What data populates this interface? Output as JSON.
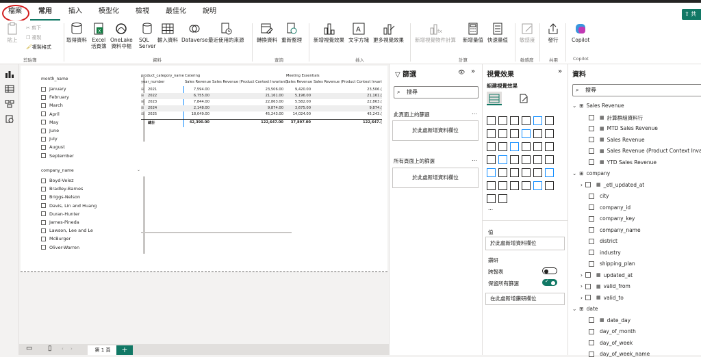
{
  "menu": {
    "tabs": [
      "檔案",
      "常用",
      "插入",
      "模型化",
      "檢視",
      "最佳化",
      "說明"
    ],
    "active_index": 1,
    "share_label": "共"
  },
  "ribbon": {
    "clipboard": {
      "paste": "貼上",
      "cut": "剪下",
      "copy": "複製",
      "format_painter": "複製格式",
      "group": "剪貼簿"
    },
    "data": {
      "get_data": "取得資料",
      "excel": "Excel\n活頁簿",
      "onelake": "OneLake\n資料中樞",
      "sql": "SQL\nServer",
      "enter_data": "輸入資料",
      "dataverse": "Dataverse",
      "recent": "最近使用的來源",
      "group": "資料"
    },
    "queries": {
      "transform": "轉換資料",
      "refresh": "重新整理",
      "group": "查詢"
    },
    "insert": {
      "new_visual": "新增視覺效果",
      "textbox": "文字方塊",
      "more_visuals": "更多視覺效果",
      "group": "插入"
    },
    "calc": {
      "new_calc_item": "新增視覺物件計算",
      "new_measure": "新增量值",
      "quick_measure": "快速量值",
      "group": "計算"
    },
    "sensitivity": {
      "label": "敏感度",
      "group": "敏感度"
    },
    "share": {
      "publish": "發行",
      "group": "共用"
    },
    "copilot": {
      "label": "Copilot",
      "group": "Copilot"
    }
  },
  "slicer_month": {
    "header": "month_name",
    "items": [
      "January",
      "February",
      "March",
      "April",
      "May",
      "June",
      "July",
      "August",
      "September"
    ]
  },
  "slicer_company": {
    "header": "company_name",
    "items": [
      "Boyd-Velez",
      "Bradley-Barnes",
      "Briggs-Nelson",
      "Davis, Lin and Huang",
      "Duran-Hunter",
      "James-Pineda",
      "Lawson, Lee and Le",
      "McBurger",
      "Oliver-Warren"
    ]
  },
  "matrix": {
    "row_header_1": "product_category_name",
    "row_header_2": "year_number",
    "col_groups": [
      "Catering",
      "Meeting Essentials"
    ],
    "col_measures": [
      "Sales Revenue",
      "Sales Revenue (Product Context Invariant)",
      "Sales Revenue",
      "Sales Revenue (Product Context Invarian"
    ],
    "rows": [
      {
        "year": "2021",
        "v": [
          "7,594.00",
          "23,506.00",
          "9,420.00",
          "23,506.("
        ]
      },
      {
        "year": "2022",
        "v": [
          "6,755.00",
          "21,161.00",
          "5,196.00",
          "21,161.("
        ]
      },
      {
        "year": "2023",
        "v": [
          "7,844.00",
          "22,863.00",
          "5,582.00",
          "22,863.("
        ]
      },
      {
        "year": "2024",
        "v": [
          "2,148.00",
          "9,874.00",
          "3,675.00",
          "9,874.("
        ]
      },
      {
        "year": "2025",
        "v": [
          "18,049.00",
          "45,243.00",
          "14,024.00",
          "45,243.("
        ]
      }
    ],
    "total": {
      "label": "總計",
      "v": [
        "42,390.00",
        "122,647.00",
        "37,897.00",
        "122,647.("
      ]
    }
  },
  "page_tabs": {
    "current": "第 1 頁",
    "add": "+"
  },
  "filters": {
    "title": "篩選",
    "search": "搜尋",
    "this_page": "此頁面上的篩選",
    "all_pages": "所有頁面上的篩選",
    "drop_here": "於此處新增資料欄位"
  },
  "visualizations": {
    "title": "視覺效果",
    "build": "組建視覺效果",
    "values": "值",
    "values_drop": "於此處新增資料欄位",
    "drillthrough": "鑽研",
    "cross_report": "跨報表",
    "keep_all_filters": "保留所有篩選",
    "drill_drop": "在此處新增鑽研欄位",
    "more": "...",
    "cross_report_on": false,
    "keep_all_filters_on": true
  },
  "data_pane": {
    "title": "資料",
    "search": "搜尋",
    "tables": [
      {
        "name": "Sales Revenue",
        "fields": [
          "計算群組資料行",
          "MTD Sales Revenue",
          "Sales Revenue",
          "Sales Revenue (Product Context Invaria",
          "YTD Sales Revenue"
        ]
      },
      {
        "name": "company",
        "fields": [
          "_etl_updated_at",
          "city",
          "company_id",
          "company_key",
          "company_name",
          "district",
          "industry",
          "shipping_plan",
          "updated_at",
          "valid_from",
          "valid_to"
        ]
      },
      {
        "name": "date",
        "fields": [
          "date_day",
          "day_of_month",
          "day_of_week",
          "day_of_week_name"
        ]
      }
    ]
  },
  "colors": {
    "accent": "#117865",
    "ring": "#d21c1c"
  }
}
